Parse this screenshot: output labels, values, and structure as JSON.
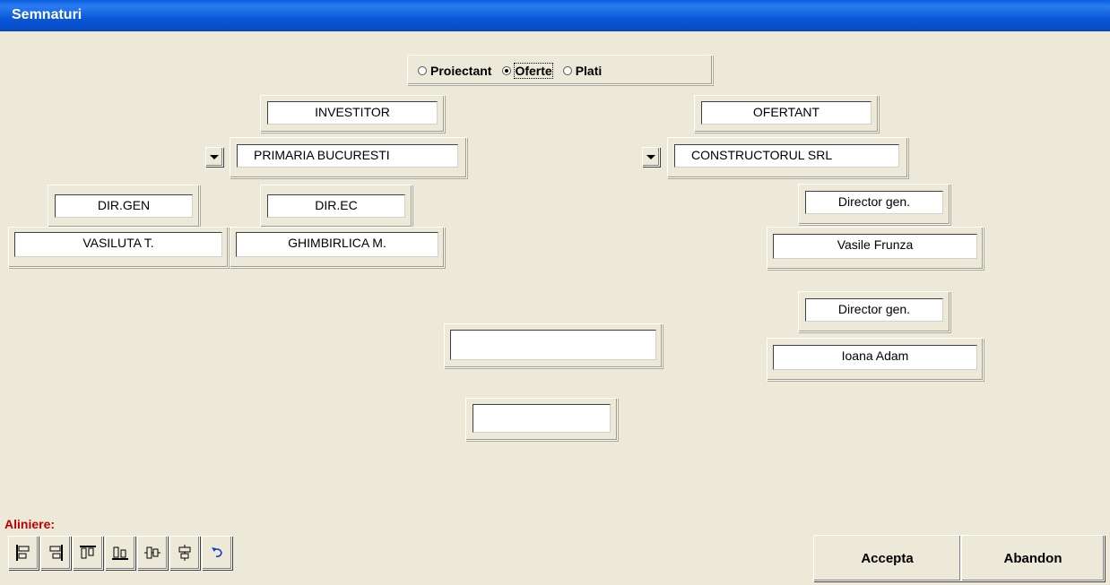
{
  "window": {
    "title": "Semnaturi"
  },
  "mode": {
    "options": [
      "Proiectant",
      "Oferte",
      "Plati"
    ],
    "selected": "Oferte"
  },
  "left": {
    "role": "INVESTITOR",
    "entity": "PRIMARIA BUCURESTI",
    "signers": [
      {
        "title": "DIR.GEN",
        "name": "VASILUTA T."
      },
      {
        "title": "DIR.EC",
        "name": "GHIMBIRLICA M."
      }
    ]
  },
  "right": {
    "role": "OFERTANT",
    "entity": "CONSTRUCTORUL SRL",
    "signers": [
      {
        "title": "Director gen.",
        "name": "Vasile Frunza"
      },
      {
        "title": "Director gen.",
        "name": "Ioana Adam"
      }
    ]
  },
  "center": {
    "field1": "",
    "field2": ""
  },
  "alignment": {
    "label": "Aliniere:",
    "buttons": [
      "align-left-icon",
      "align-right-icon",
      "align-top-icon",
      "align-bottom-icon",
      "center-vertical-icon",
      "center-horizontal-icon",
      "undo-icon"
    ]
  },
  "actions": {
    "accept": "Accepta",
    "cancel": "Abandon"
  },
  "colors": {
    "titlebar": "#0a5fe0",
    "alignLabel": "#c00000",
    "face": "#ece9d8"
  }
}
